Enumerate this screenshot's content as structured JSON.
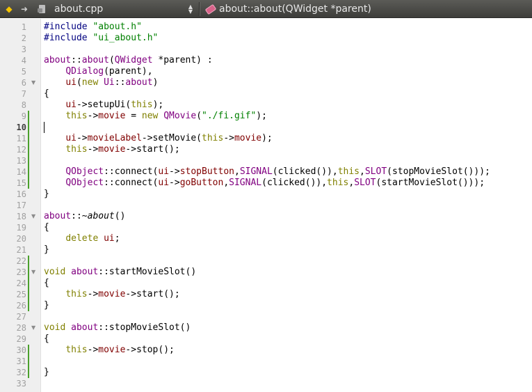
{
  "toolbar": {
    "file_name": "about.cpp",
    "function_name": "about::about(QWidget *parent)",
    "file_icon": "locked-file-icon",
    "function_icon": "function-tag-icon",
    "back_icon": "back-arrow-icon",
    "forward_icon": "forward-arrow-icon"
  },
  "editor": {
    "current_line": 10,
    "line_numbers": [
      "1",
      "2",
      "3",
      "4",
      "5",
      "6",
      "7",
      "8",
      "9",
      "10",
      "11",
      "12",
      "13",
      "14",
      "15",
      "16",
      "17",
      "18",
      "19",
      "20",
      "21",
      "22",
      "23",
      "24",
      "25",
      "26",
      "27",
      "28",
      "29",
      "30",
      "31",
      "32",
      "33"
    ],
    "lines": [
      [
        {
          "t": "#include ",
          "c": "pp"
        },
        {
          "t": "\"about.h\"",
          "c": "str"
        }
      ],
      [
        {
          "t": "#include ",
          "c": "pp"
        },
        {
          "t": "\"ui_about.h\"",
          "c": "str"
        }
      ],
      [],
      [
        {
          "t": "about",
          "c": "typ"
        },
        {
          "t": "::",
          "c": ""
        },
        {
          "t": "about",
          "c": "typ"
        },
        {
          "t": "(",
          "c": ""
        },
        {
          "t": "QWidget",
          "c": "typ"
        },
        {
          "t": " *parent) :",
          "c": ""
        }
      ],
      [
        {
          "t": "    ",
          "c": ""
        },
        {
          "t": "QDialog",
          "c": "typ"
        },
        {
          "t": "(parent),",
          "c": ""
        }
      ],
      [
        {
          "t": "    ",
          "c": ""
        },
        {
          "t": "ui",
          "c": "var"
        },
        {
          "t": "(",
          "c": ""
        },
        {
          "t": "new",
          "c": "kw"
        },
        {
          "t": " ",
          "c": ""
        },
        {
          "t": "Ui",
          "c": "typ"
        },
        {
          "t": "::",
          "c": ""
        },
        {
          "t": "about",
          "c": "typ"
        },
        {
          "t": ")",
          "c": ""
        }
      ],
      [
        {
          "t": "{",
          "c": ""
        }
      ],
      [
        {
          "t": "    ",
          "c": ""
        },
        {
          "t": "ui",
          "c": "var"
        },
        {
          "t": "->setupUi(",
          "c": ""
        },
        {
          "t": "this",
          "c": "kw"
        },
        {
          "t": ");",
          "c": ""
        }
      ],
      [
        {
          "t": "    ",
          "c": ""
        },
        {
          "t": "this",
          "c": "kw"
        },
        {
          "t": "->",
          "c": ""
        },
        {
          "t": "movie",
          "c": "var"
        },
        {
          "t": " = ",
          "c": ""
        },
        {
          "t": "new",
          "c": "kw"
        },
        {
          "t": " ",
          "c": ""
        },
        {
          "t": "QMovie",
          "c": "typ"
        },
        {
          "t": "(",
          "c": ""
        },
        {
          "t": "\"./fi.gif\"",
          "c": "str"
        },
        {
          "t": ");",
          "c": ""
        }
      ],
      [],
      [
        {
          "t": "    ",
          "c": ""
        },
        {
          "t": "ui",
          "c": "var"
        },
        {
          "t": "->",
          "c": ""
        },
        {
          "t": "movieLabel",
          "c": "var"
        },
        {
          "t": "->setMovie(",
          "c": ""
        },
        {
          "t": "this",
          "c": "kw"
        },
        {
          "t": "->",
          "c": ""
        },
        {
          "t": "movie",
          "c": "var"
        },
        {
          "t": ");",
          "c": ""
        }
      ],
      [
        {
          "t": "    ",
          "c": ""
        },
        {
          "t": "this",
          "c": "kw"
        },
        {
          "t": "->",
          "c": ""
        },
        {
          "t": "movie",
          "c": "var"
        },
        {
          "t": "->start();",
          "c": ""
        }
      ],
      [],
      [
        {
          "t": "    ",
          "c": ""
        },
        {
          "t": "QObject",
          "c": "typ"
        },
        {
          "t": "::connect(",
          "c": ""
        },
        {
          "t": "ui",
          "c": "var"
        },
        {
          "t": "->",
          "c": ""
        },
        {
          "t": "stopButton",
          "c": "var"
        },
        {
          "t": ",",
          "c": ""
        },
        {
          "t": "SIGNAL",
          "c": "typ"
        },
        {
          "t": "(clicked()),",
          "c": ""
        },
        {
          "t": "this",
          "c": "kw"
        },
        {
          "t": ",",
          "c": ""
        },
        {
          "t": "SLOT",
          "c": "typ"
        },
        {
          "t": "(stopMovieSlot()));",
          "c": ""
        }
      ],
      [
        {
          "t": "    ",
          "c": ""
        },
        {
          "t": "QObject",
          "c": "typ"
        },
        {
          "t": "::connect(",
          "c": ""
        },
        {
          "t": "ui",
          "c": "var"
        },
        {
          "t": "->",
          "c": ""
        },
        {
          "t": "goButton",
          "c": "var"
        },
        {
          "t": ",",
          "c": ""
        },
        {
          "t": "SIGNAL",
          "c": "typ"
        },
        {
          "t": "(clicked()),",
          "c": ""
        },
        {
          "t": "this",
          "c": "kw"
        },
        {
          "t": ",",
          "c": ""
        },
        {
          "t": "SLOT",
          "c": "typ"
        },
        {
          "t": "(startMovieSlot()));",
          "c": ""
        }
      ],
      [
        {
          "t": "}",
          "c": ""
        }
      ],
      [],
      [
        {
          "t": "about",
          "c": "typ"
        },
        {
          "t": "::~",
          "c": ""
        },
        {
          "t": "about",
          "c": "it"
        },
        {
          "t": "()",
          "c": ""
        }
      ],
      [
        {
          "t": "{",
          "c": ""
        }
      ],
      [
        {
          "t": "    ",
          "c": ""
        },
        {
          "t": "delete",
          "c": "kw"
        },
        {
          "t": " ",
          "c": ""
        },
        {
          "t": "ui",
          "c": "var"
        },
        {
          "t": ";",
          "c": ""
        }
      ],
      [
        {
          "t": "}",
          "c": ""
        }
      ],
      [],
      [
        {
          "t": "void",
          "c": "kw"
        },
        {
          "t": " ",
          "c": ""
        },
        {
          "t": "about",
          "c": "typ"
        },
        {
          "t": "::startMovieSlot()",
          "c": ""
        }
      ],
      [
        {
          "t": "{",
          "c": ""
        }
      ],
      [
        {
          "t": "    ",
          "c": ""
        },
        {
          "t": "this",
          "c": "kw"
        },
        {
          "t": "->",
          "c": ""
        },
        {
          "t": "movie",
          "c": "var"
        },
        {
          "t": "->start();",
          "c": ""
        }
      ],
      [
        {
          "t": "}",
          "c": ""
        }
      ],
      [],
      [
        {
          "t": "void",
          "c": "kw"
        },
        {
          "t": " ",
          "c": ""
        },
        {
          "t": "about",
          "c": "typ"
        },
        {
          "t": "::stopMovieSlot()",
          "c": ""
        }
      ],
      [
        {
          "t": "{",
          "c": ""
        }
      ],
      [
        {
          "t": "    ",
          "c": ""
        },
        {
          "t": "this",
          "c": "kw"
        },
        {
          "t": "->",
          "c": ""
        },
        {
          "t": "movie",
          "c": "var"
        },
        {
          "t": "->stop();",
          "c": ""
        }
      ],
      [],
      [
        {
          "t": "}",
          "c": ""
        }
      ],
      []
    ],
    "fold_markers": [
      6,
      18,
      23,
      28
    ],
    "changed_lines": [
      9,
      10,
      11,
      12,
      13,
      14,
      15,
      22,
      23,
      24,
      25,
      26,
      30,
      31,
      32
    ],
    "colors": {
      "keyword": "#808000",
      "string": "#008000",
      "preprocessor": "#000080",
      "type": "#800080",
      "member": "#800000",
      "change_marker": "#4aa02c"
    }
  }
}
